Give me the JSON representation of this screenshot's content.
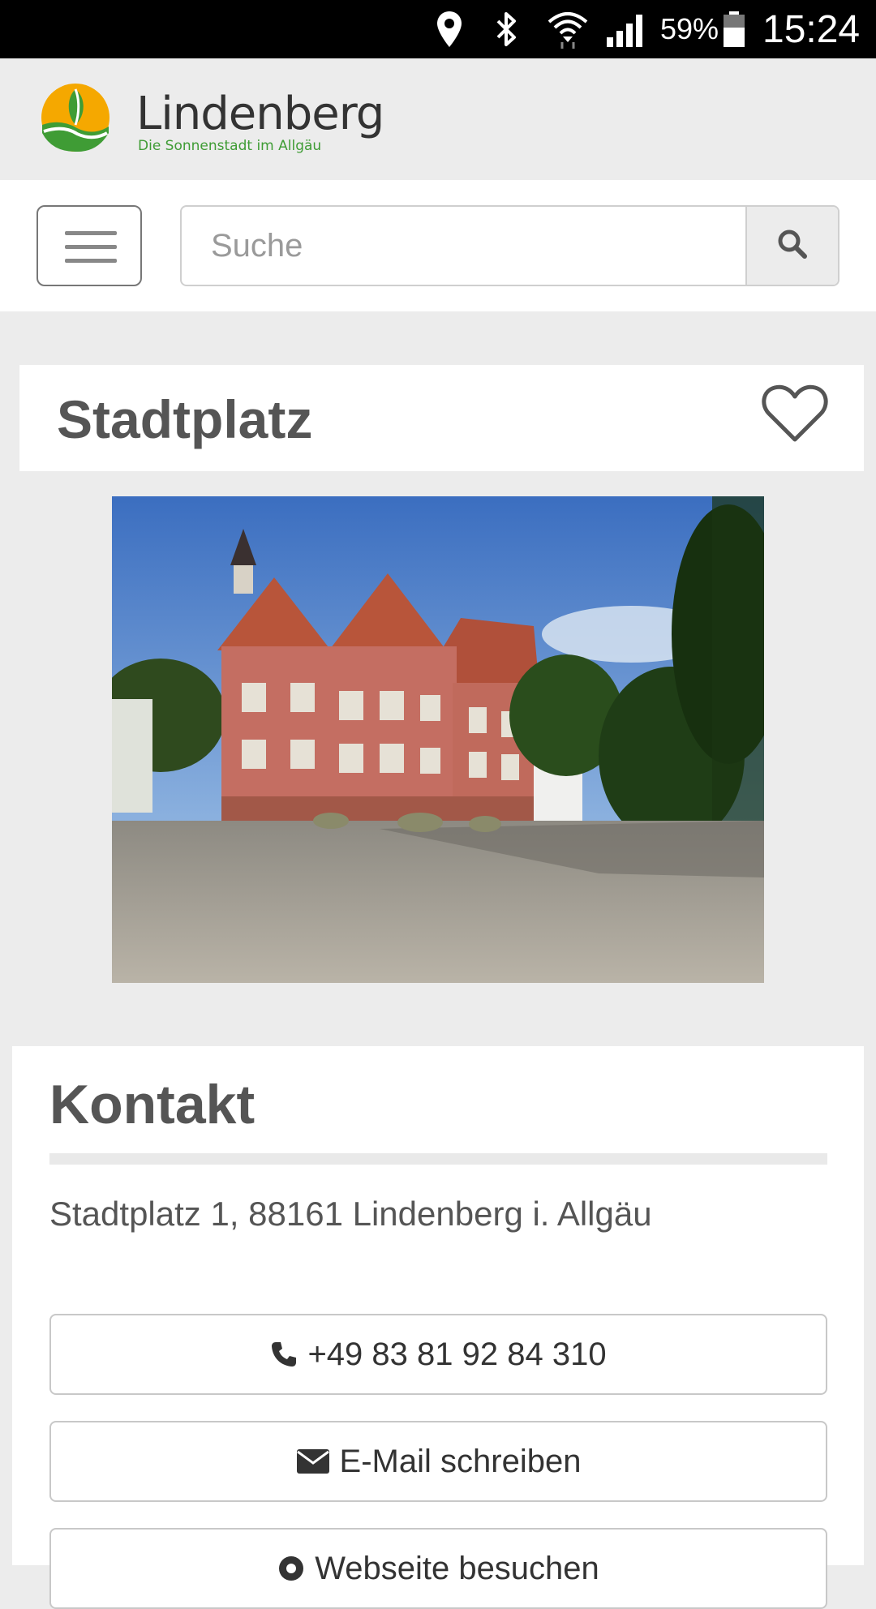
{
  "status_bar": {
    "icons": [
      "location-icon",
      "bluetooth-icon",
      "wifi-icon",
      "signal-icon",
      "battery-icon"
    ],
    "battery_percent": "59%",
    "time": "15:24"
  },
  "brand": {
    "name": "Lindenberg",
    "tagline": "Die Sonnenstadt im Allgäu",
    "colors": {
      "sun": "#f5a800",
      "green": "#3f9c35"
    }
  },
  "navbar": {
    "menu_icon": "hamburger-menu-icon",
    "search": {
      "placeholder": "Suche",
      "value": "",
      "button_icon": "search-icon"
    }
  },
  "place": {
    "title": "Stadtplatz",
    "favorite_icon": "heart-outline-icon",
    "photo": "town-hall-square-photo"
  },
  "contact": {
    "heading": "Kontakt",
    "address": "Stadtplatz 1, 88161 Lindenberg i. Allgäu",
    "buttons": [
      {
        "icon": "phone-icon",
        "label": "+49 83 81 92 84 310"
      },
      {
        "icon": "envelope-icon",
        "label": "E-Mail schreiben"
      },
      {
        "icon": "globe-icon",
        "label": "Webseite besuchen"
      }
    ]
  }
}
